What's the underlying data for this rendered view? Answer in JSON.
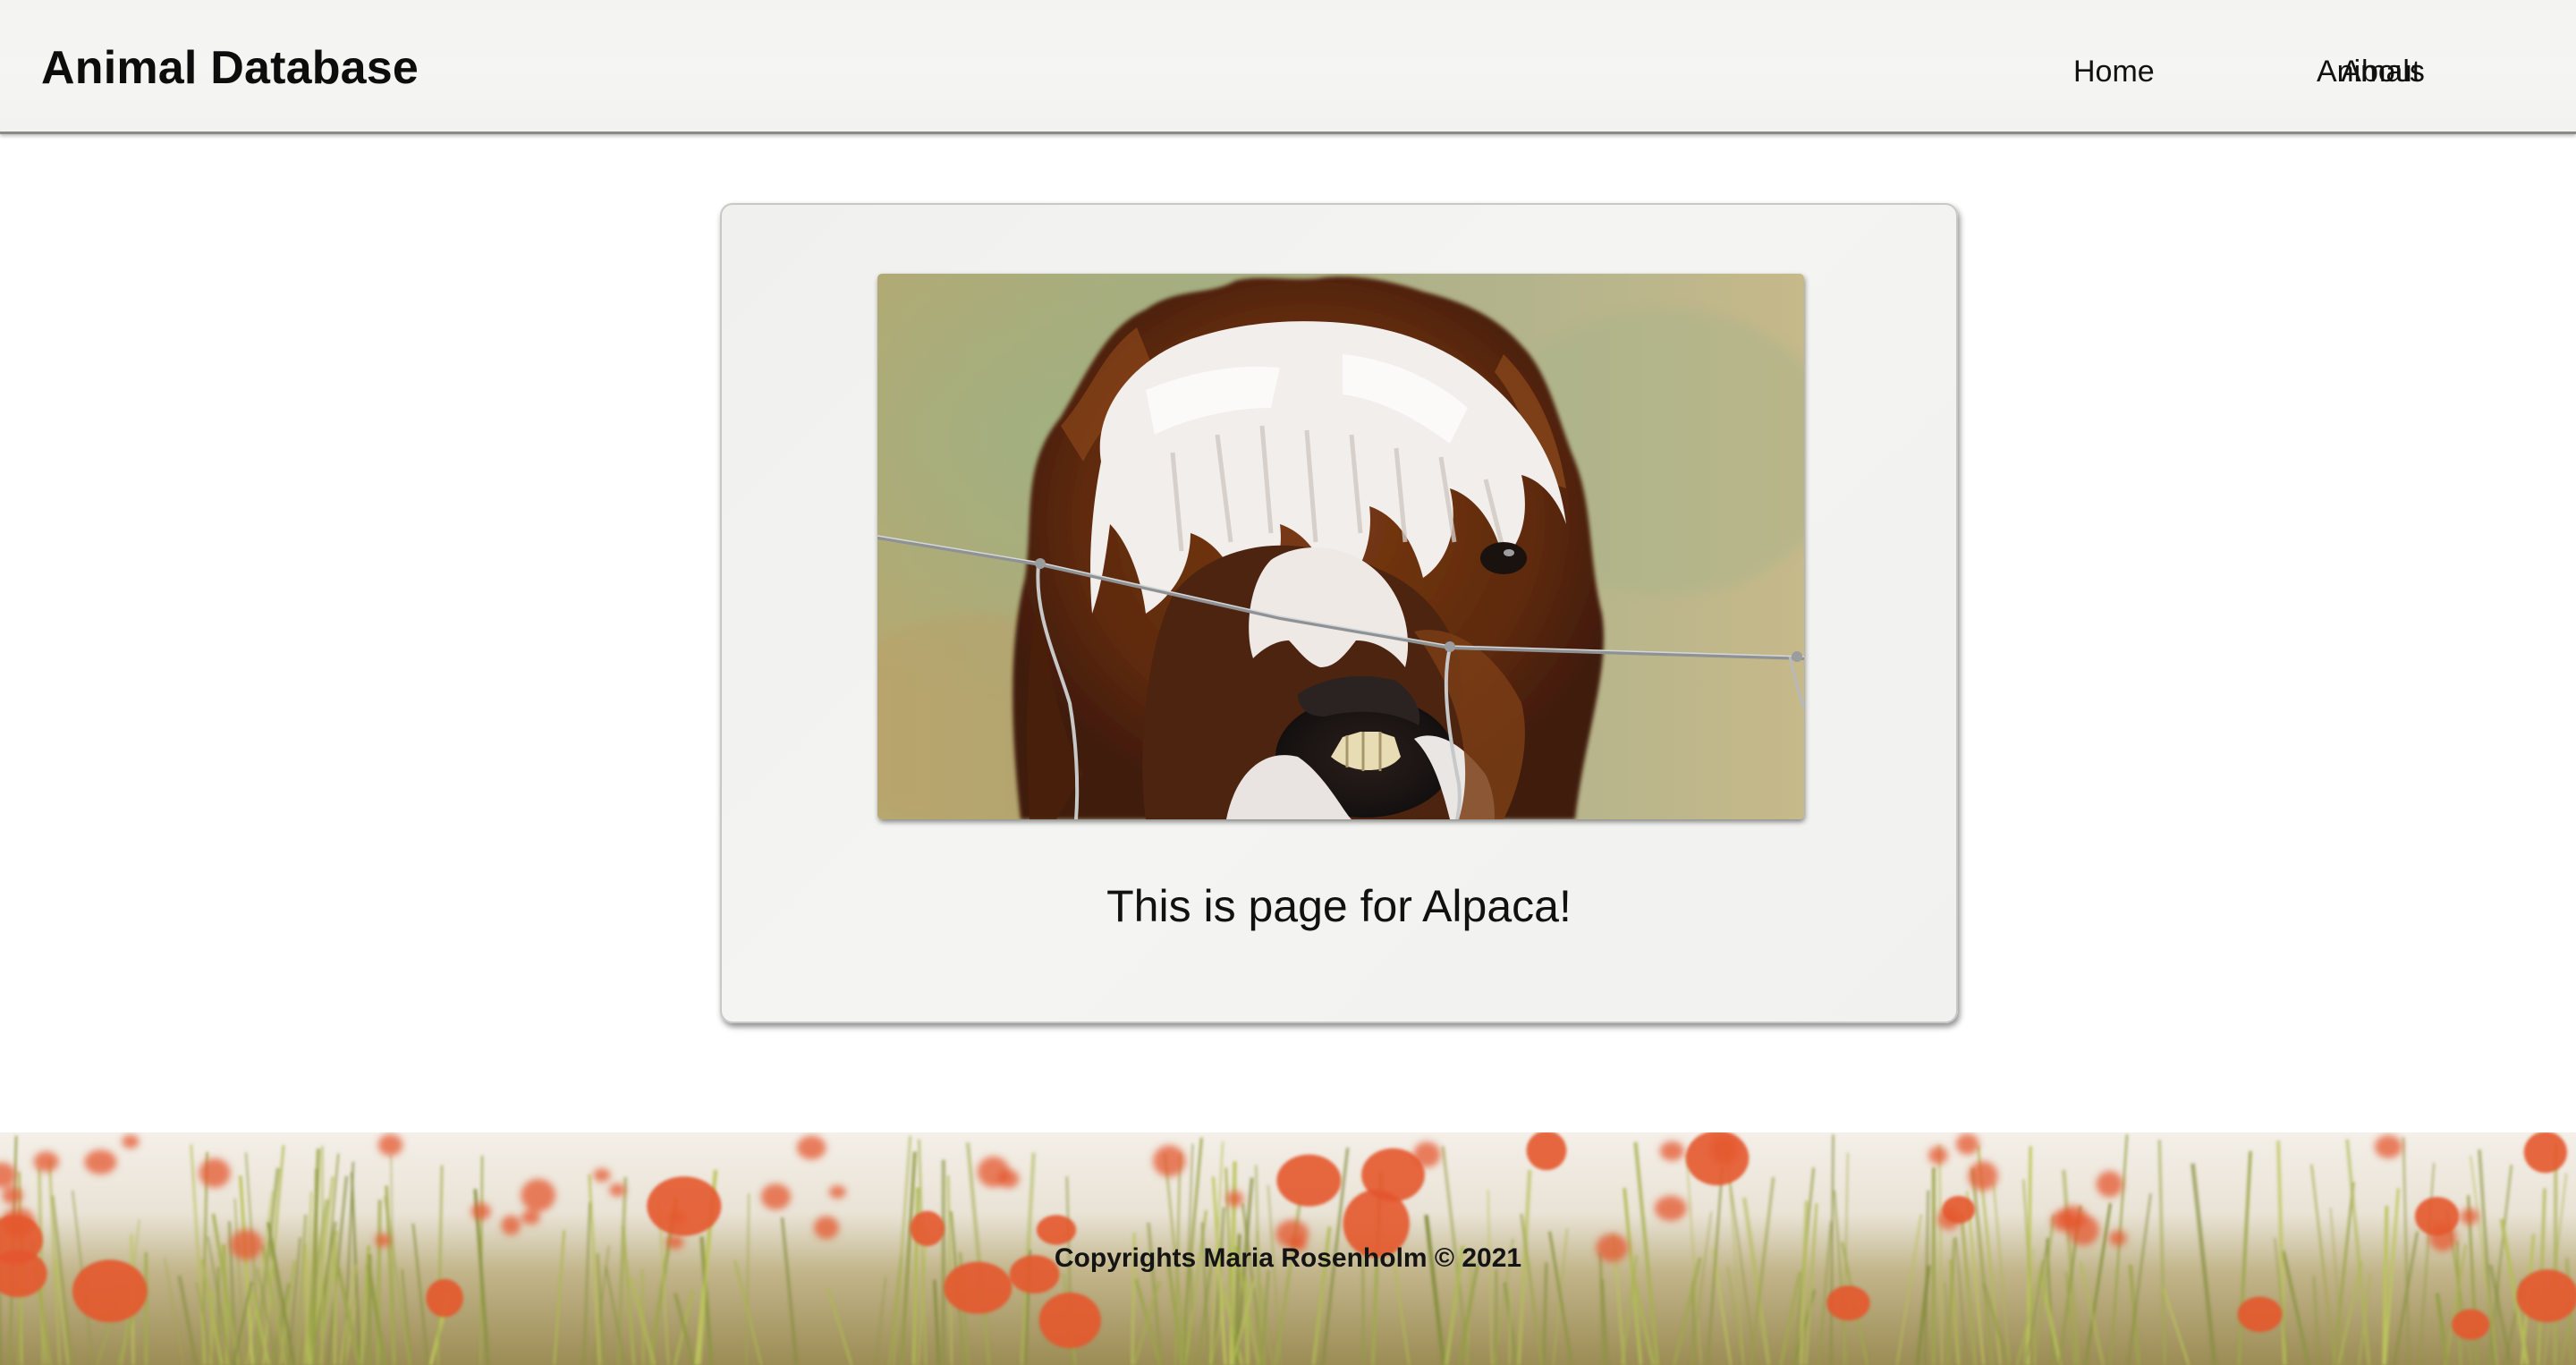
{
  "header": {
    "site_title": "Animal Database",
    "nav": [
      {
        "label": "Home"
      },
      {
        "label": "Animals"
      },
      {
        "label": "About"
      }
    ]
  },
  "card": {
    "image_subject": "alpaca-photo",
    "caption": "This is page for Alpaca!"
  },
  "footer": {
    "copyright": "Copyrights Maria Rosenholm © 2021",
    "background_subject": "poppy-field"
  },
  "colors": {
    "header_bg": "#f4f4f2",
    "header_border": "#8a8a8a",
    "card_bg": "#f2f2f0",
    "text": "#111111",
    "poppy": "#e4562f"
  }
}
